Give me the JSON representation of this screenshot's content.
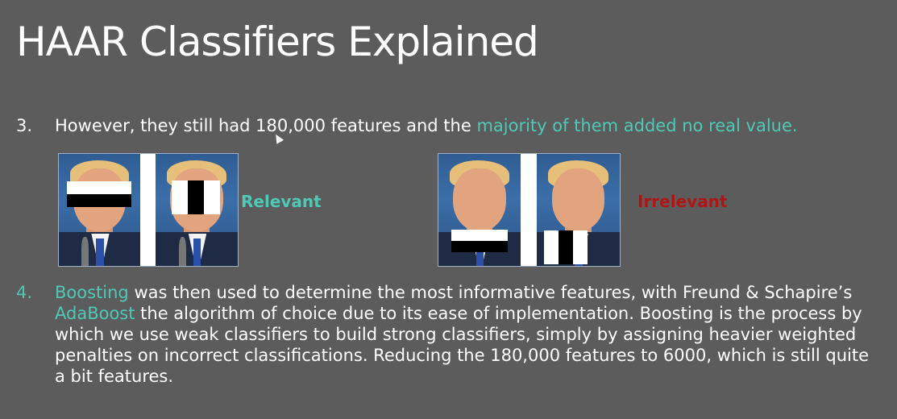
{
  "slide": {
    "title": "HAAR Classifiers Explained"
  },
  "item3": {
    "number": "3.",
    "text_plain": "However, they still had 180,000 features and the ",
    "text_highlight": "majority of them added no real value."
  },
  "panels": {
    "relevant_label": "Relevant",
    "irrelevant_label": "Irrelevant"
  },
  "item4": {
    "number": "4.",
    "term_boosting": "Boosting",
    "text_a": " was then used to determine the most informative features, with Freund & Schapire’s ",
    "term_adaboost": "AdaBoost",
    "text_b": " the algorithm of choice due to its ease of implementation. Boosting is the process by which we use weak classifiers to build strong classifiers, simply by assigning heavier weighted penalties on incorrect classifications.  Reducing the 180,000 features to 6000, which is still quite a bit features."
  },
  "colors": {
    "background": "#5c5c5c",
    "accent_teal": "#4fc9b6",
    "irrelevant_red": "#b01515",
    "text": "#ffffff"
  }
}
